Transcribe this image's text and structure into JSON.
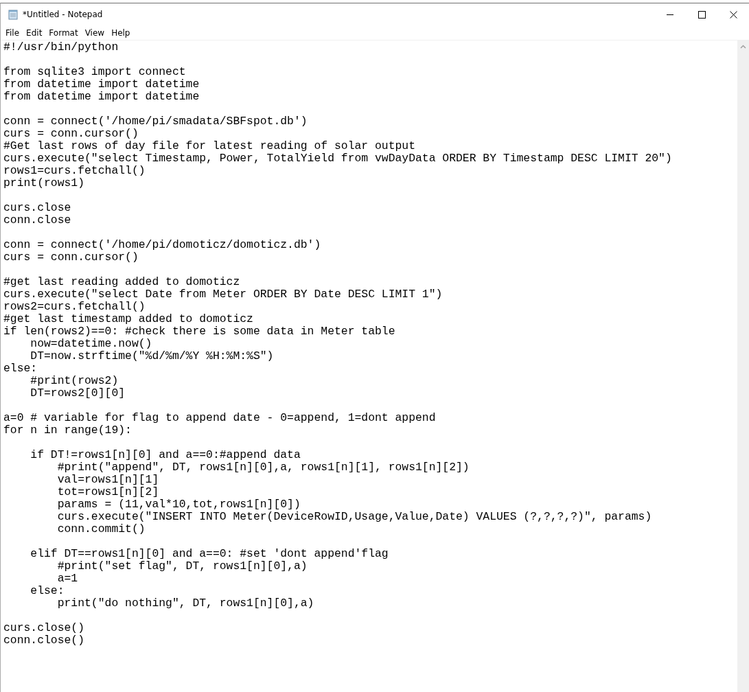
{
  "window": {
    "title": "*Untitled - Notepad"
  },
  "menu": [
    "File",
    "Edit",
    "Format",
    "View",
    "Help"
  ],
  "editor": {
    "text": "#!/usr/bin/python\n\nfrom sqlite3 import connect\nfrom datetime import datetime\nfrom datetime import datetime\n\nconn = connect('/home/pi/smadata/SBFspot.db')\ncurs = conn.cursor()\n#Get last rows of day file for latest reading of solar output\ncurs.execute(\"select Timestamp, Power, TotalYield from vwDayData ORDER BY Timestamp DESC LIMIT 20\")\nrows1=curs.fetchall()\nprint(rows1)\n\ncurs.close\nconn.close\n\nconn = connect('/home/pi/domoticz/domoticz.db')\ncurs = conn.cursor()\n\n#get last reading added to domoticz\ncurs.execute(\"select Date from Meter ORDER BY Date DESC LIMIT 1\")\nrows2=curs.fetchall()\n#get last timestamp added to domoticz\nif len(rows2)==0: #check there is some data in Meter table\n    now=datetime.now()\n    DT=now.strftime(\"%d/%m/%Y %H:%M:%S\")\nelse:\n    #print(rows2)\n    DT=rows2[0][0]\n\na=0 # variable for flag to append date - 0=append, 1=dont append\nfor n in range(19):\n\n    if DT!=rows1[n][0] and a==0:#append data\n        #print(\"append\", DT, rows1[n][0],a, rows1[n][1], rows1[n][2])\n        val=rows1[n][1]\n        tot=rows1[n][2]\n        params = (11,val*10,tot,rows1[n][0])\n        curs.execute(\"INSERT INTO Meter(DeviceRowID,Usage,Value,Date) VALUES (?,?,?,?)\", params)\n        conn.commit()\n\n    elif DT==rows1[n][0] and a==0: #set 'dont append'flag\n        #print(\"set flag\", DT, rows1[n][0],a)\n        a=1\n    else:\n        print(\"do nothing\", DT, rows1[n][0],a)\n\ncurs.close()\nconn.close()"
  }
}
